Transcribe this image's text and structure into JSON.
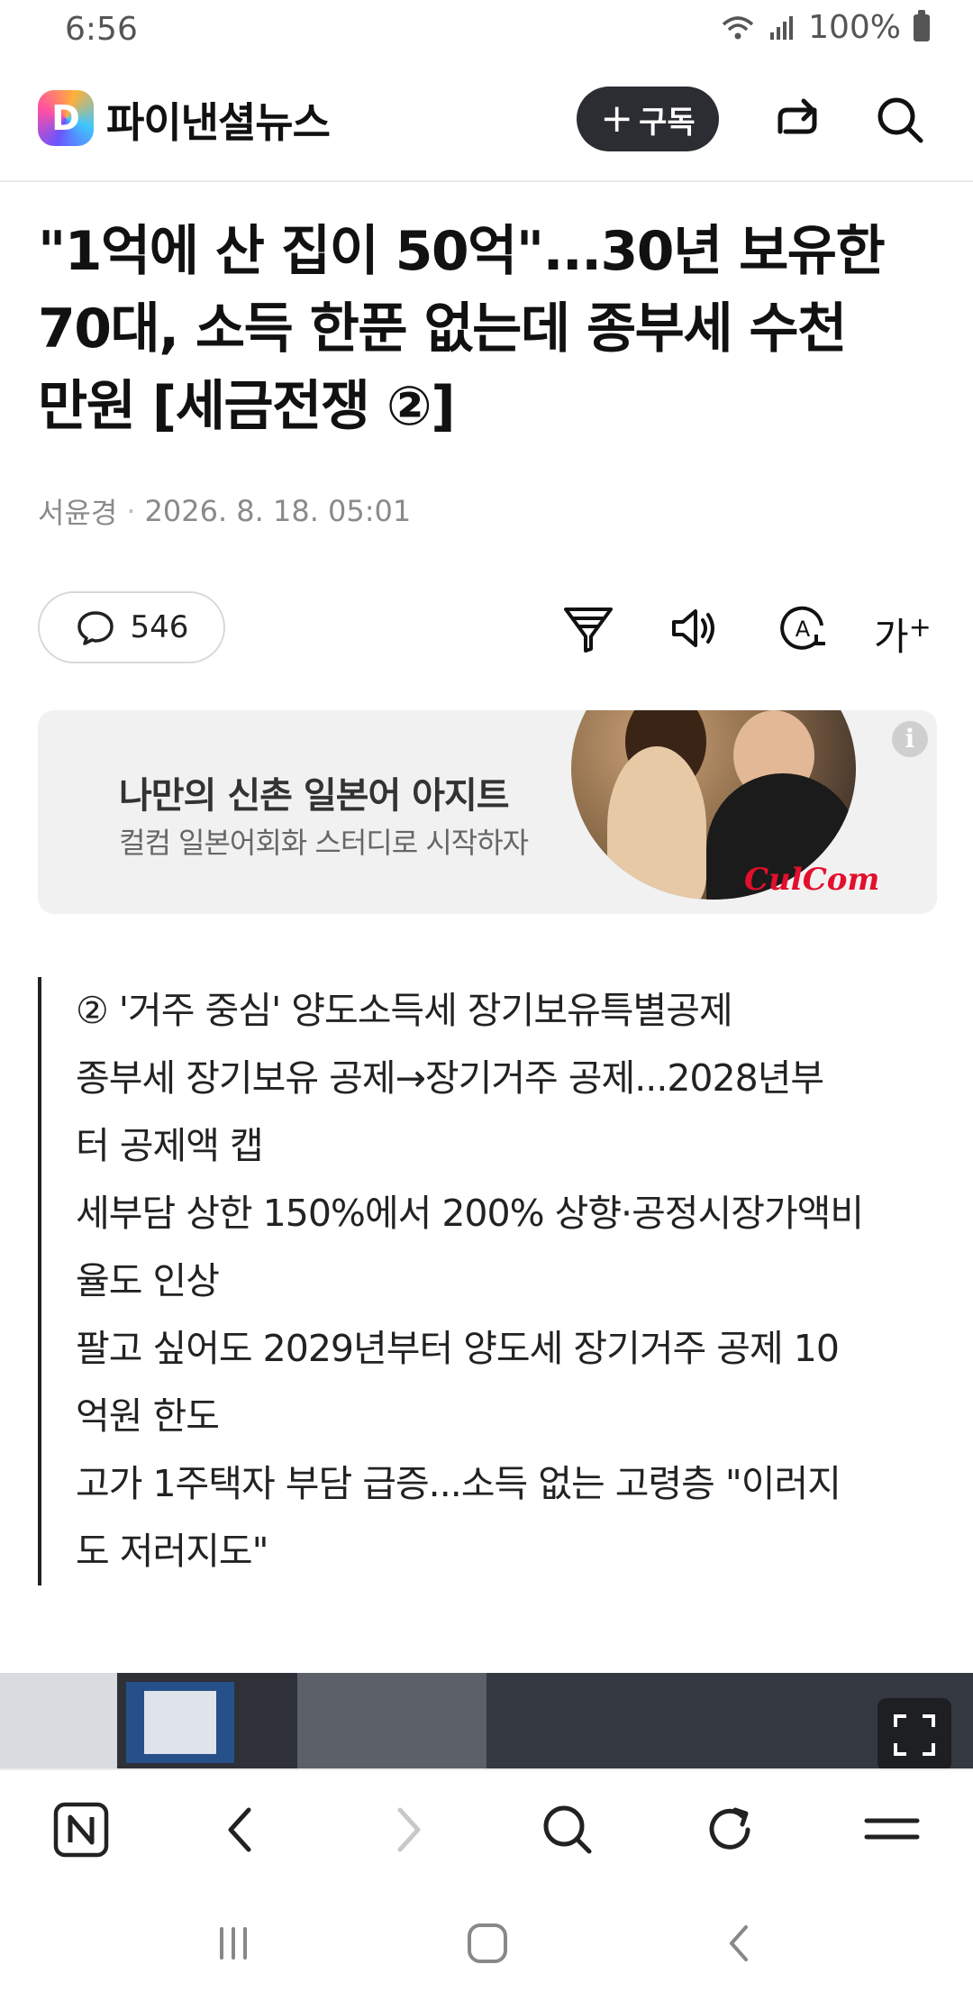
{
  "status_bar": {
    "time": "6:56",
    "battery": "100%"
  },
  "header": {
    "brand": "파이낸셜뉴스",
    "logo_letter": "D",
    "subscribe_label": "구독"
  },
  "article": {
    "title_lines": [
      "\"1억에 산 집이 50억\"...30년 보유한",
      "70대, 소득 한푼 없는데 종부세 수천",
      "만원 [세금전쟁 ②]"
    ],
    "author": "서윤경",
    "date": "2026. 8. 18. 05:01",
    "comment_count": "546",
    "font_size_label": "가"
  },
  "ad": {
    "title": "나만의 신촌 일본어 아지트",
    "subtitle": "컬컴 일본어회화 스터디로 시작하자",
    "brand": "CulCom",
    "info": "i"
  },
  "summary_lines": [
    "② '거주 중심' 양도소득세 장기보유특별공제",
    "종부세 장기보유 공제→장기거주 공제...2028년부",
    "터 공제액 캡",
    "세부담 상한 150%에서 200% 상향·공정시장가액비",
    "율도 인상",
    "팔고 싶어도 2029년부터 양도세 장기거주 공제 10",
    "억원 한도",
    "고가 1주택자 부담 급증...소득 없는 고령층 \"이러지",
    "도 저러지도\""
  ],
  "icons": {
    "header": [
      "share-icon",
      "search-icon"
    ],
    "toolbar": [
      "comment-icon",
      "summary-filter-icon",
      "speaker-icon",
      "translate-icon",
      "font-size-icon"
    ],
    "bottom_nav": [
      "naver-home-icon",
      "back-icon",
      "forward-icon",
      "search-icon",
      "refresh-icon",
      "menu-icon"
    ],
    "system_nav": [
      "recent-apps-icon",
      "home-icon",
      "system-back-icon"
    ]
  },
  "colors": {
    "subscribe_bg": "#2b2d33",
    "ad_brand": "#e30f2d",
    "forward_disabled": "#c8c8c8"
  }
}
